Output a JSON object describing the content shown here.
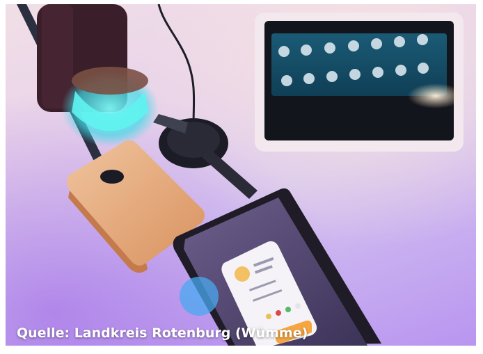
{
  "caption": "Quelle: Landkreis Rotenburg (Wümme)",
  "colors": {
    "background_top": "#f1dfe6",
    "background_bottom": "#b995f0",
    "hub_panel": "#1e5a72",
    "lamp_ring": "#5ff3f0",
    "wood": "#e9b48a",
    "tablet_card": "#f5f3f7",
    "accent_orange": "#f6a540"
  },
  "icons": [
    "desk-lamp",
    "smartwatch",
    "wireless-charger",
    "smart-display",
    "tablet",
    "light-bulb-icon"
  ]
}
